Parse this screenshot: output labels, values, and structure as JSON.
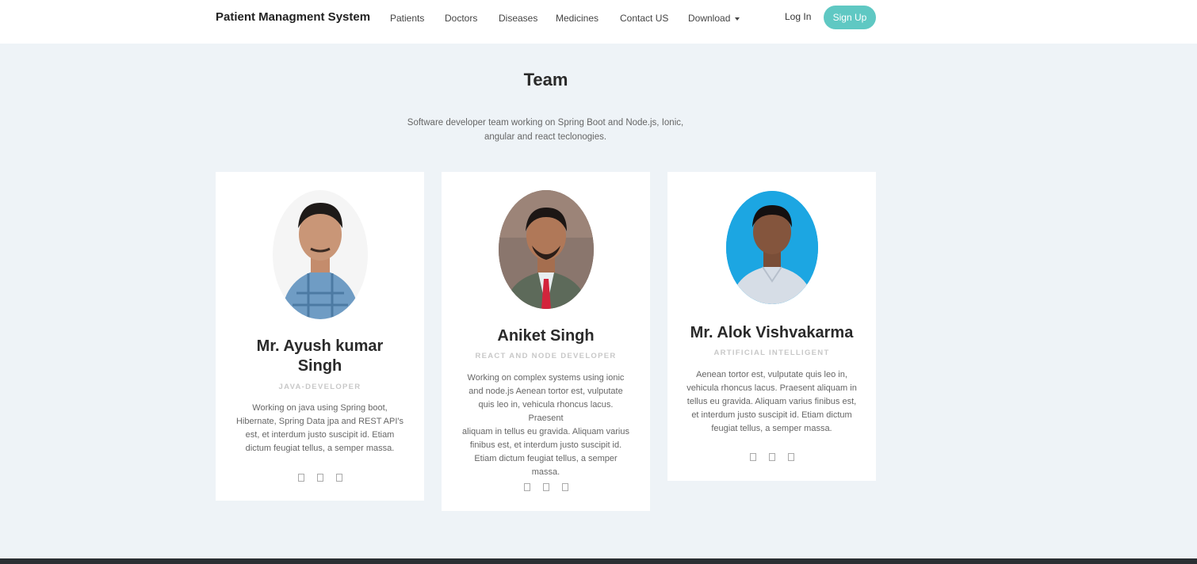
{
  "nav": {
    "brand": "Patient Managment System",
    "links": [
      "Patients",
      "Doctors",
      "Diseases",
      "Medicines",
      "Contact US",
      "Download"
    ],
    "login": "Log In",
    "signup": "Sign Up"
  },
  "team": {
    "title": "Team",
    "subtitle_line1": "Software developer team working on Spring Boot and Node.js, Ionic,",
    "subtitle_line2": "angular and react teclonogies."
  },
  "members": [
    {
      "name_line1": "Mr. Ayush kumar",
      "name_line2": "Singh",
      "role": "JAVA-DEVELOPER",
      "desc": [
        "Working on java using Spring boot,",
        "Hibernate, Spring Data jpa and REST API's",
        "est, et interdum justo suscipit id. Etiam",
        "dictum feugiat tellus, a semper massa."
      ]
    },
    {
      "name": "Aniket Singh",
      "role": "REACT AND NODE DEVELOPER",
      "desc": [
        "Working on complex systems using ionic",
        "and node.js Aenean tortor est, vulputate",
        "quis leo in, vehicula rhoncus lacus. Praesent",
        "aliquam in tellus eu gravida. Aliquam varius",
        "finibus est, et interdum justo suscipit id.",
        "Etiam dictum feugiat tellus, a semper",
        "massa."
      ]
    },
    {
      "name": "Mr. Alok Vishvakarma",
      "role": "ARTIFICIAL INTELLIGENT",
      "desc": [
        "Aenean tortor est, vulputate quis leo in,",
        "vehicula rhoncus lacus. Praesent aliquam in",
        "tellus eu gravida. Aliquam varius finibus est,",
        "et interdum justo suscipit id. Etiam dictum",
        "feugiat tellus, a semper massa."
      ]
    }
  ],
  "social_icons": [
    "social-icon",
    "social-icon",
    "social-icon"
  ]
}
